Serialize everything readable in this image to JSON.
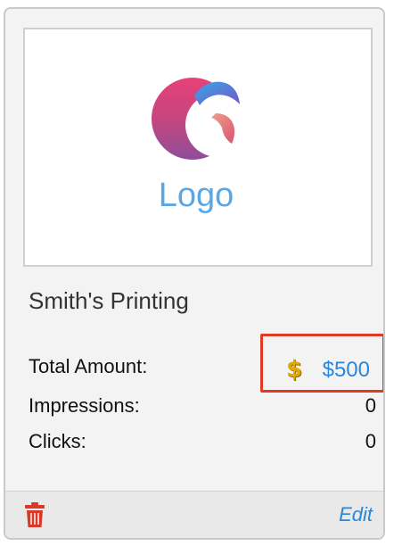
{
  "card": {
    "logo_text": "Logo",
    "advertiser_name": "Smith's Printing"
  },
  "stats": {
    "total_amount_label": "Total Amount:",
    "total_amount_value": "$500",
    "impressions_label": "Impressions:",
    "impressions_value": "0",
    "clicks_label": "Clicks:",
    "clicks_value": "0"
  },
  "footer": {
    "edit_label": "Edit",
    "delete_icon": "trash-icon"
  },
  "icons": {
    "amount_icon": "dollar-icon"
  },
  "colors": {
    "accent_blue": "#2a86d8",
    "highlight_red": "#e03a22",
    "trash_red": "#d9392b",
    "dollar_gold": "#e0a800"
  }
}
